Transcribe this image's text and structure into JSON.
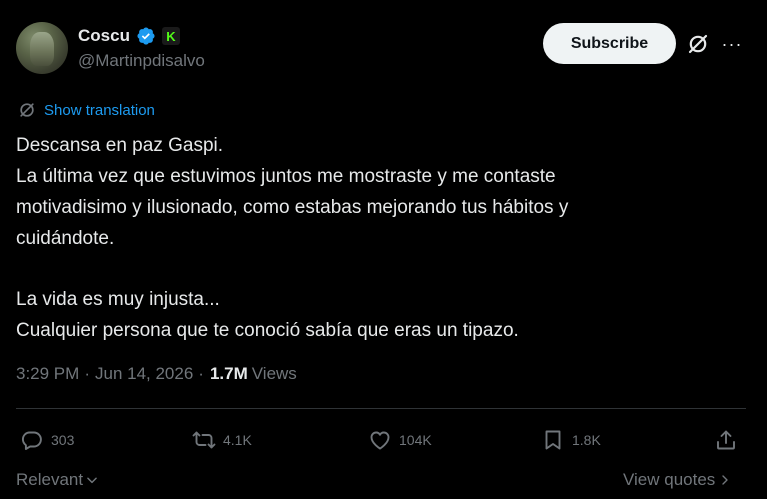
{
  "author": {
    "display_name": "Coscu",
    "handle": "@Martinpdisalvo",
    "badge_letter": "K"
  },
  "header": {
    "subscribe_label": "Subscribe"
  },
  "translate": {
    "label": "Show translation"
  },
  "tweet": {
    "lines_a": [
      "Descansa en paz Gaspi.",
      "La última vez que estuvimos juntos me mostraste y me contaste",
      "motivadisimo y ilusionado, como estabas mejorando tus hábitos y",
      "cuidándote."
    ],
    "lines_b": [
      "La vida es muy injusta...",
      "Cualquier persona que te conoció sabía que eras un tipazo."
    ]
  },
  "meta": {
    "time": "3:29 PM",
    "separator": "·",
    "date": "Jun 14, 2026",
    "views_count": "1.7M",
    "views_label": "Views"
  },
  "actions": {
    "replies": "303",
    "reposts": "4.1K",
    "likes": "104K",
    "bookmarks": "1.8K"
  },
  "footer": {
    "sort_label": "Relevant",
    "quotes_label": "View quotes"
  },
  "colors": {
    "accent": "#1d9bf0",
    "background": "#000000",
    "text": "#e7e9ea",
    "muted": "#71767b",
    "kick_green": "#53fc18"
  }
}
